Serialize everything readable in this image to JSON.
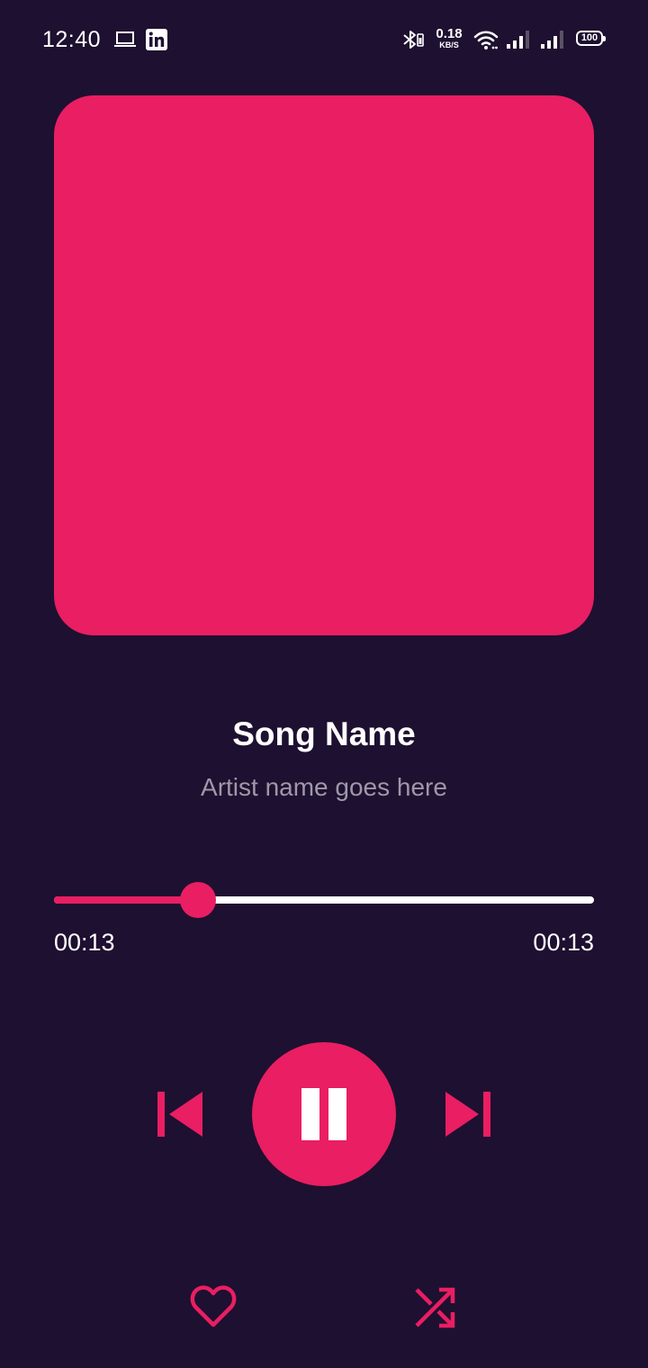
{
  "status_bar": {
    "time": "12:40",
    "net_speed_value": "0.18",
    "net_speed_unit": "KB/S",
    "battery_level": "100",
    "icons": [
      "laptop-icon",
      "linkedin-icon",
      "bluetooth-icon",
      "wifi-icon",
      "signal-icon-1",
      "signal-icon-2",
      "battery-icon"
    ]
  },
  "player": {
    "song_name": "Song Name",
    "artist_name": "Artist name goes here",
    "progress_fraction": 0.25,
    "elapsed_time": "00:13",
    "total_time": "00:13",
    "is_playing": true
  },
  "controls": {
    "previous": "skip-previous-icon",
    "play_pause": "pause-icon",
    "next": "skip-next-icon",
    "favorite": "heart-icon",
    "shuffle": "shuffle-icon"
  },
  "colors": {
    "background": "#1e1030",
    "accent": "#e91e63",
    "text_primary": "#ffffff",
    "text_secondary": "#9e98a8"
  }
}
